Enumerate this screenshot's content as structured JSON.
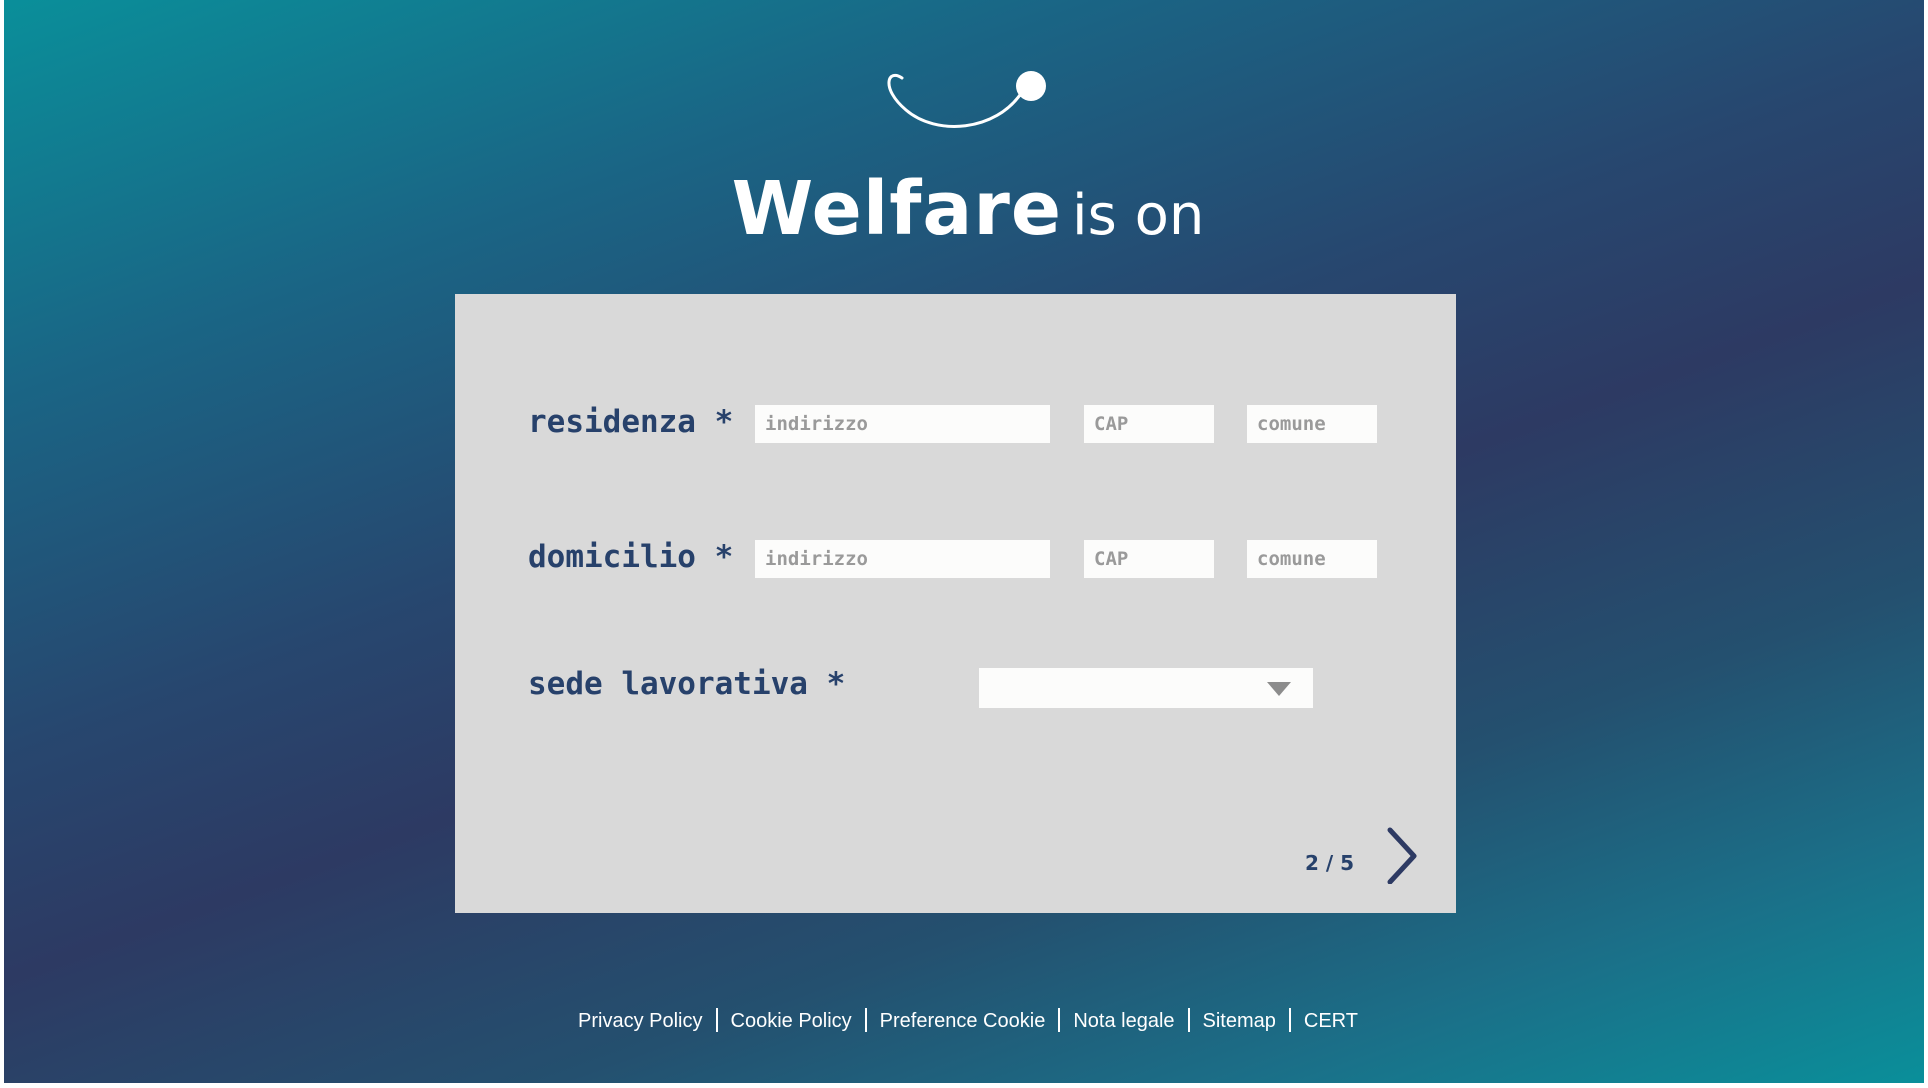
{
  "header": {
    "title_strong": "Welfare",
    "title_light": "is on"
  },
  "form": {
    "residenza": {
      "label": "residenza *",
      "indirizzo_placeholder": "indirizzo",
      "cap_placeholder": "CAP",
      "comune_placeholder": "comune"
    },
    "domicilio": {
      "label": "domicilio *",
      "indirizzo_placeholder": "indirizzo",
      "cap_placeholder": "CAP",
      "comune_placeholder": "comune"
    },
    "sede_lavorativa": {
      "label": "sede lavorativa *",
      "selected_value": ""
    },
    "pager": "2 / 5",
    "next_icon": "chevron-right-icon"
  },
  "footer": {
    "links": [
      "Privacy Policy",
      "Cookie Policy",
      "Preference Cookie",
      "Nota legale",
      "Sitemap",
      "CERT"
    ]
  },
  "colors": {
    "gradient_teal": "#0a8f9a",
    "gradient_navy": "#2d3a63",
    "card_bg": "#d9d9d9",
    "label_color": "#27416b",
    "field_bg": "#fcfcfb",
    "text_white": "#ffffff"
  }
}
